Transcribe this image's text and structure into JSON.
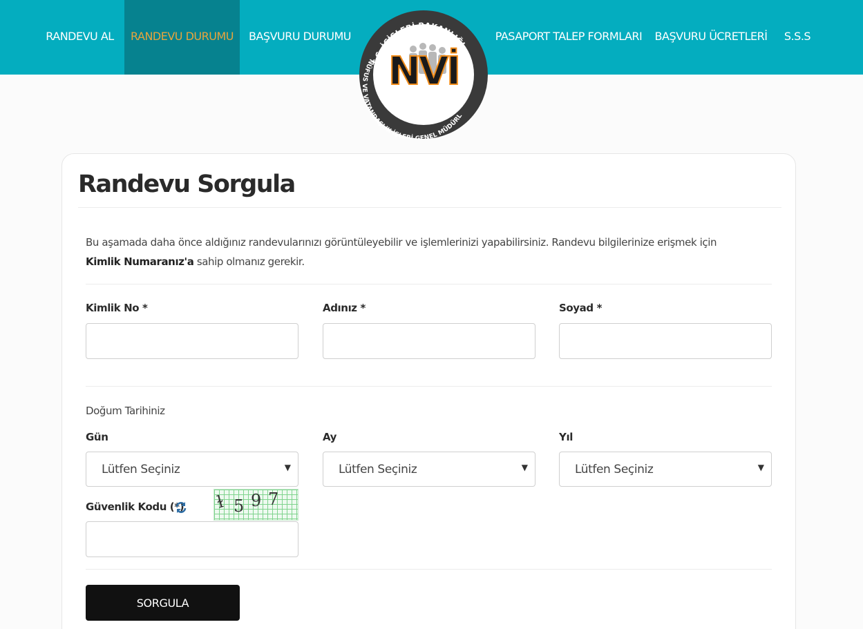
{
  "nav": {
    "items": [
      {
        "label": "RANDEVU AL"
      },
      {
        "label": "RANDEVU DURUMU"
      },
      {
        "label": "BAŞVURU DURUMU"
      },
      {
        "label": "PASAPORT TALEP FORMLARI"
      },
      {
        "label": "BAŞVURU ÜCRETLERİ"
      },
      {
        "label": "S.S.S"
      }
    ],
    "active_index": 1,
    "active_color": "#e8a53d"
  },
  "logo": {
    "mark": "NVİ",
    "top_text": "T.C. İÇİŞLERİ BAKANLIĞI",
    "ring_text": "NÜFUS VE VATANDAŞLIK İŞLERİ GENEL MÜDÜRLÜĞÜ"
  },
  "form": {
    "title": "Randevu Sorgula",
    "intro_text": "Bu aşamada daha önce aldığınız randevularınızı görüntüleyebilir ve işlemlerinizi yapabilirsiniz. Randevu bilgilerinize erişmek için ",
    "intro_bold": "Kimlik Numaranız'a",
    "intro_tail": " sahip olmanız gerekir.",
    "fields": {
      "kimlik_label": "Kimlik No *",
      "kimlik_value": "",
      "ad_label": "Adınız *",
      "ad_value": "",
      "soyad_label": "Soyad *",
      "soyad_value": ""
    },
    "birth": {
      "title": "Doğum Tarihiniz",
      "day_label": "Gün",
      "day_value": "Lütfen Seçiniz",
      "month_label": "Ay",
      "month_value": "Lütfen Seçiniz",
      "year_label": "Yıl",
      "year_value": "Lütfen Seçiniz"
    },
    "security": {
      "label": "Güvenlik Kodu (*)",
      "captcha_chars": [
        "ɫ",
        "5",
        "9",
        "7"
      ],
      "value": ""
    },
    "submit_label": "SORGULA"
  },
  "colors": {
    "header_bg": "#04adbf",
    "active_nav_bg": "#06828f",
    "button_bg": "#111111",
    "logo_orange": "#f08c1a"
  },
  "icons": {
    "refresh": "refresh-icon",
    "dropdown": "chevron-down-icon"
  }
}
